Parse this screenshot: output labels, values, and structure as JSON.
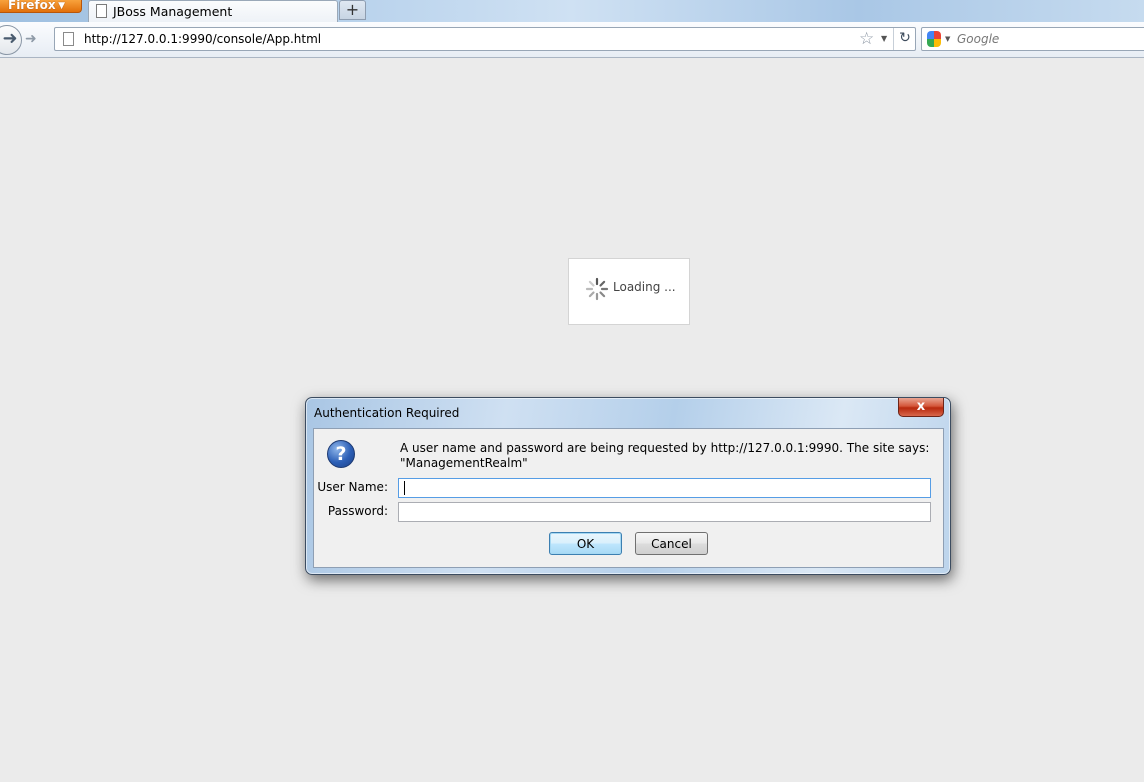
{
  "browser": {
    "menu_button": "Firefox",
    "tab_title": "JBoss Management",
    "new_tab_label": "+",
    "url": "http://127.0.0.1:9990/console/App.html",
    "search_placeholder": "Google"
  },
  "page": {
    "loading_text": "Loading ..."
  },
  "dialog": {
    "title": "Authentication Required",
    "close_label": "x",
    "message_line1": "A user name and password are being requested by http://127.0.0.1:9990. The site says:",
    "message_line2": "\"ManagementRealm\"",
    "username_label": "User Name:",
    "username_value": "",
    "password_label": "Password:",
    "password_value": "",
    "ok_label": "OK",
    "cancel_label": "Cancel"
  },
  "colors": {
    "firefox_orange": "#e2700a",
    "close_red": "#c2391d",
    "question_blue": "#2c5fb6",
    "page_background": "#ebebeb"
  }
}
